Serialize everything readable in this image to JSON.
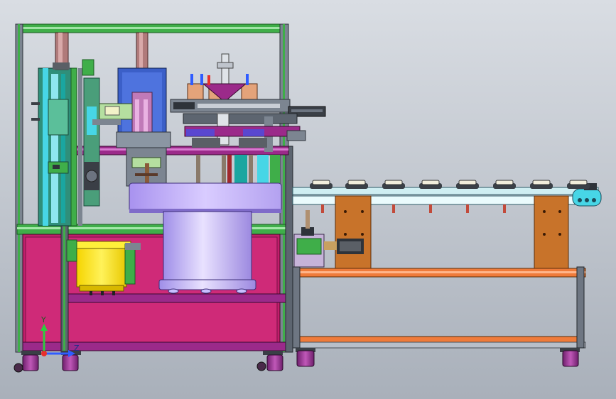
{
  "viewport": {
    "background_top": "#d9dde3",
    "background_bottom": "#a9b0ba"
  },
  "axis_triad": {
    "y_label": "Y",
    "z_label": "Z",
    "y_color": "#2ecc40",
    "x_color": "#e8302c",
    "z_color": "#2f5cff"
  },
  "colors": {
    "frame_green": "#3fae49",
    "frame_gray": "#6e7682",
    "cabinet_magenta": "#c01e6b",
    "cabinet_purple": "#9b2a8a",
    "feeder_yellow": "#ffe600",
    "turntable_lavender": "#b9a8f2",
    "cylinder_lilac": "#d8c9ff",
    "conveyor_cyan": "#cfeef2",
    "bracket_orange": "#c8732a",
    "rail_orange": "#ef7b3a",
    "caster_purple": "#8e2f8a",
    "blue_block": "#3b5fc8",
    "cyan_column": "#47d6e6",
    "teal": "#1aa6a0"
  }
}
